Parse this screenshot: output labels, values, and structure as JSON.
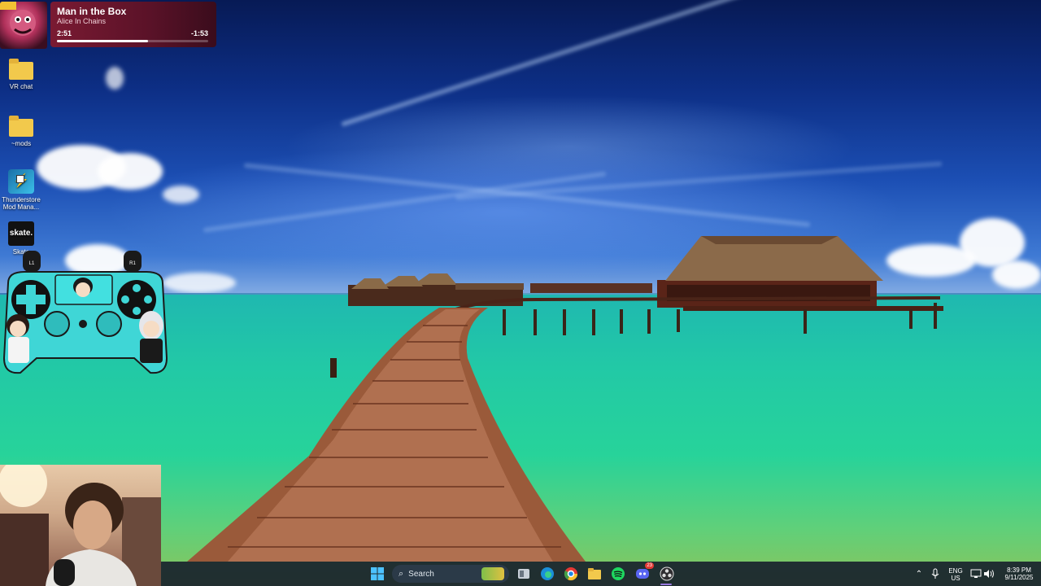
{
  "now_playing": {
    "title": "Man in the Box",
    "artist": "Alice In Chains",
    "elapsed": "2:51",
    "remaining": "-1:53",
    "progress": 0.6
  },
  "desktop_icons": [
    {
      "label": "VR chat",
      "icon": "folder-icon"
    },
    {
      "label": "~mods",
      "icon": "folder-icon"
    },
    {
      "label": "Thunderstore Mod Mana...",
      "icon": "thunderstore-icon"
    },
    {
      "label": "Skate",
      "icon": "skate-icon",
      "logo_text": "skate."
    }
  ],
  "controller": {
    "l_label": "L1",
    "r_label": "R1"
  },
  "taskbar": {
    "search_label": "Search",
    "apps": [
      "windows-start-icon",
      "widgets-icon",
      "file-explorer-icon",
      "edge-icon",
      "chrome-icon",
      "folder-icon",
      "spotify-icon",
      "discord-icon",
      "obs-icon"
    ],
    "discord_badge": "23",
    "tray": {
      "lang_top": "ENG",
      "lang_bottom": "US",
      "time": "8:39 PM",
      "date": "9/11/2025"
    }
  },
  "colors": {
    "taskbar_bg": "#18222c",
    "np_card": "#6a1630",
    "sea": "#22c9a6"
  }
}
